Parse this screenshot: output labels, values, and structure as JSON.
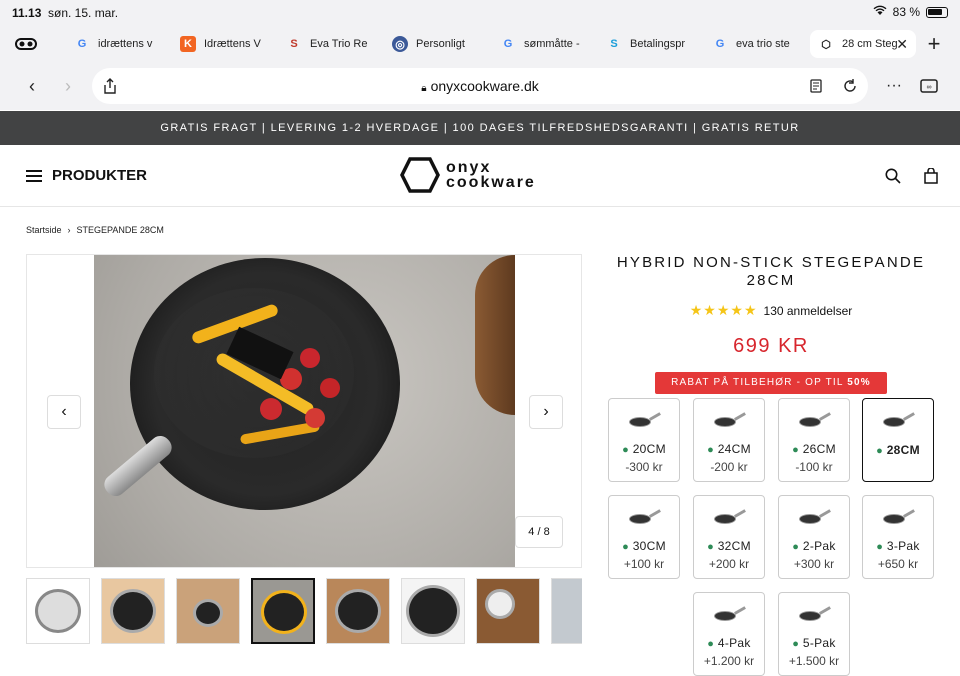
{
  "status_bar": {
    "time": "11.13",
    "date": "søn. 15. mar.",
    "battery": "83 %"
  },
  "tabs": [
    {
      "label": "idrættens v",
      "favicon": "G"
    },
    {
      "label": "Idrættens V",
      "favicon": "K"
    },
    {
      "label": "Eva Trio Re",
      "favicon": "S"
    },
    {
      "label": "Personligt",
      "favicon": "◎"
    },
    {
      "label": "sømmåtte -",
      "favicon": "G"
    },
    {
      "label": "Betalingspr",
      "favicon": "S"
    },
    {
      "label": "eva trio ste",
      "favicon": "G"
    },
    {
      "label": "28 cm Steg",
      "favicon": "⬡"
    }
  ],
  "address_bar": {
    "url": "onyxcookware.dk"
  },
  "promo_bar": {
    "text": "GRATIS FRAGT | LEVERING 1-2 HVERDAGE | 100 DAGES TILFREDSHEDSGARANTI | GRATIS RETUR"
  },
  "header": {
    "menu_label": "PRODUKTER",
    "logo_line1": "onyx",
    "logo_line2": "cookware"
  },
  "breadcrumb": {
    "home": "Startside",
    "current": "STEGEPANDE 28CM"
  },
  "gallery": {
    "counter": "4 / 8"
  },
  "product": {
    "title": "HYBRID NON-STICK STEGEPANDE 28CM",
    "rating_stars": "★★★★★",
    "reviews": "130 anmeldelser",
    "price": "699 KR",
    "badge_prefix": "RABAT PÅ TILBEHØR - OP TIL ",
    "badge_bold": "50%"
  },
  "variants": [
    {
      "label": "20CM",
      "price": "-300 kr"
    },
    {
      "label": "24CM",
      "price": "-200 kr"
    },
    {
      "label": "26CM",
      "price": "-100 kr"
    },
    {
      "label": "28CM",
      "price": "",
      "selected": true
    },
    {
      "label": "30CM",
      "price": "+100 kr"
    },
    {
      "label": "32CM",
      "price": "+200 kr"
    },
    {
      "label": "2-Pak",
      "price": "+300 kr"
    },
    {
      "label": "3-Pak",
      "price": "+650 kr"
    },
    {
      "label": "4-Pak",
      "price": "+1.200 kr"
    },
    {
      "label": "5-Pak",
      "price": "+1.500 kr"
    }
  ],
  "colors": {
    "price_red": "#d7262d",
    "badge_red": "#e43838",
    "promo_bg": "#424344",
    "stock_green": "#2e8b57"
  }
}
